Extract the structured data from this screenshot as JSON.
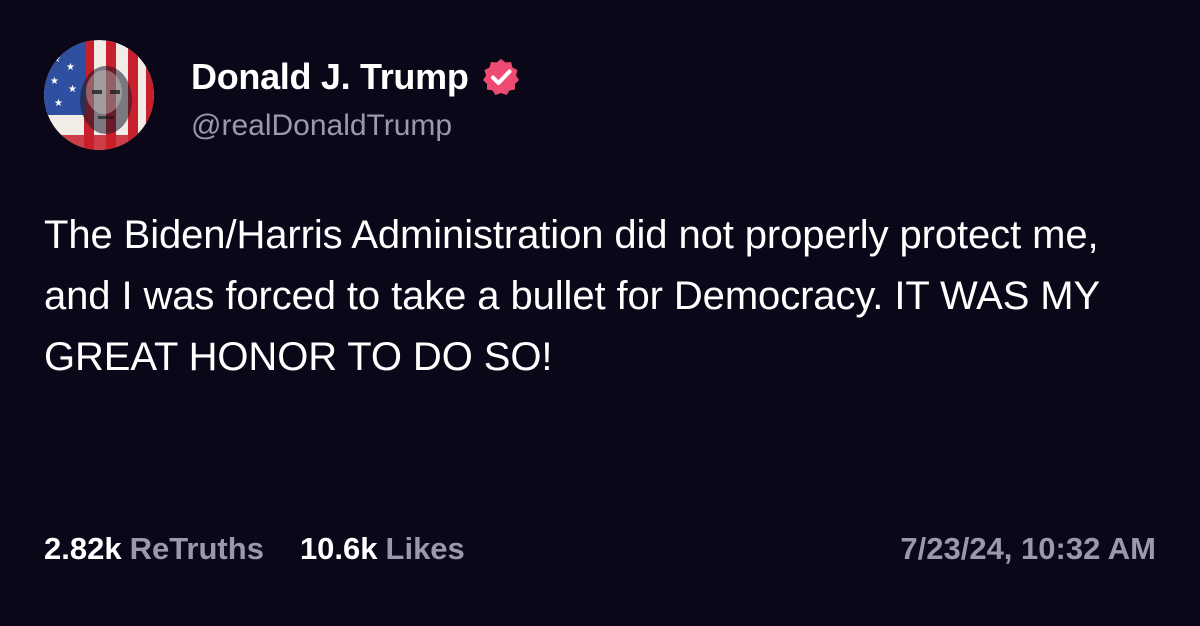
{
  "author": {
    "display_name": "Donald J. Trump",
    "handle": "@realDonaldTrump",
    "verified": true,
    "verified_color": "#ee4b72",
    "avatar_icon": "flag-portrait-avatar"
  },
  "post": {
    "text": "The Biden/Harris Administration did not properly protect me, and I was forced to take a bullet for Democracy. IT WAS MY GREAT HONOR TO DO SO!"
  },
  "stats": {
    "retruths_count": "2.82k",
    "retruths_label": "ReTruths",
    "likes_count": "10.6k",
    "likes_label": "Likes"
  },
  "timestamp": "7/23/24, 10:32 AM",
  "colors": {
    "background": "#0a0818",
    "text_primary": "#ffffff",
    "text_secondary": "#9a98ab"
  }
}
